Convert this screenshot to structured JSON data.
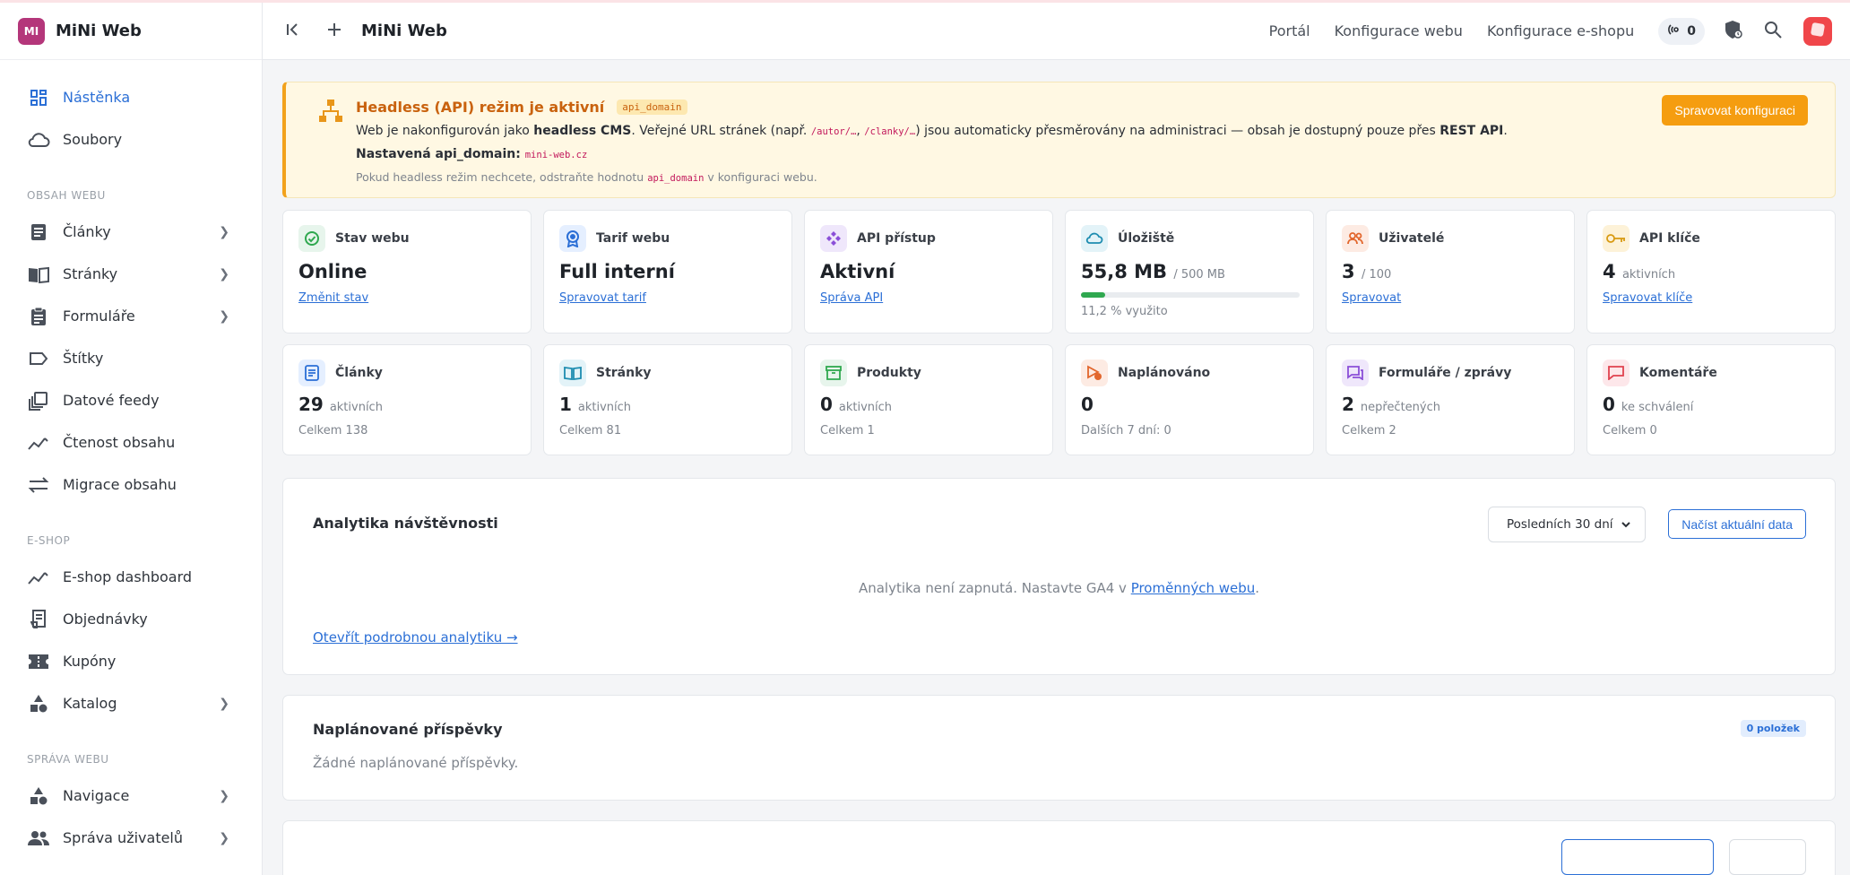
{
  "brand": {
    "logo_text": "MI",
    "name": "MiNi Web"
  },
  "sidebar": {
    "items_top": [
      {
        "label": "Nástěnka",
        "icon": "dashboard-icon",
        "active": true
      },
      {
        "label": "Soubory",
        "icon": "cloud-icon"
      }
    ],
    "section_content": "OBSAH WEBU",
    "items_content": [
      {
        "label": "Články",
        "icon": "article-icon",
        "chevron": true
      },
      {
        "label": "Stránky",
        "icon": "book-icon",
        "chevron": true
      },
      {
        "label": "Formuláře",
        "icon": "clipboard-icon",
        "chevron": true
      },
      {
        "label": "Štítky",
        "icon": "tag-icon"
      },
      {
        "label": "Datové feedy",
        "icon": "feed-icon"
      },
      {
        "label": "Čtenost obsahu",
        "icon": "trend-icon"
      },
      {
        "label": "Migrace obsahu",
        "icon": "swap-icon"
      }
    ],
    "section_eshop": "E-SHOP",
    "items_eshop": [
      {
        "label": "E-shop dashboard",
        "icon": "trend-icon"
      },
      {
        "label": "Objednávky",
        "icon": "receipt-icon"
      },
      {
        "label": "Kupóny",
        "icon": "ticket-icon"
      },
      {
        "label": "Katalog",
        "icon": "shapes-icon",
        "chevron": true
      }
    ],
    "section_manage": "SPRÁVA WEBU",
    "items_manage": [
      {
        "label": "Navigace",
        "icon": "shapes-icon",
        "chevron": true
      },
      {
        "label": "Správa uživatelů",
        "icon": "users-icon",
        "chevron": true
      }
    ]
  },
  "header": {
    "title": "MiNi Web",
    "links": [
      "Portál",
      "Konfigurace webu",
      "Konfigurace e-shopu"
    ],
    "counter": "0"
  },
  "alert": {
    "title": "Headless (API) režim je aktivní",
    "badge": "api_domain",
    "line1_a": "Web je nakonfigurován jako ",
    "line1_b": "headless CMS",
    "line1_c": ". Veřejné URL stránek (např. ",
    "line1_code1": "/autor/…",
    "line1_sep": ", ",
    "line1_code2": "/clanky/…",
    "line1_d": ") jsou automaticky přesměrovány na administraci — obsah je dostupný pouze přes ",
    "line1_e": "REST API",
    "line1_f": ".",
    "line2_label": "Nastavená api_domain: ",
    "line2_code": "mini-web.cz",
    "line3_a": "Pokud headless režim nechcete, odstraňte hodnotu ",
    "line3_code": "api_domain",
    "line3_b": " v konfiguraci webu.",
    "button": "Spravovat konfiguraci"
  },
  "cards_row1": [
    {
      "title": "Stav webu",
      "value": "Online",
      "link": "Změnit stav",
      "icon": "check-circle-icon",
      "tint": "#e7f5ec",
      "color": "#2fa84f"
    },
    {
      "title": "Tarif webu",
      "value": "Full interní",
      "link": "Spravovat tarif",
      "icon": "badge-icon",
      "tint": "#e5efff",
      "color": "#2b6fd6"
    },
    {
      "title": "API přístup",
      "value": "Aktivní",
      "link": "Správa API",
      "icon": "api-icon",
      "tint": "#efe7fb",
      "color": "#8b4fd8"
    },
    {
      "title": "Úložiště",
      "value": "55,8 MB",
      "suffix": "/ 500 MB",
      "note": "11,2 % využito",
      "progress": 0.112,
      "icon": "cloud-icon",
      "tint": "#e3f3f8",
      "color": "#1d8cb0"
    },
    {
      "title": "Uživatelé",
      "value": "3",
      "suffix": "/ 100",
      "link": "Spravovat",
      "icon": "users-icon",
      "tint": "#fdebe3",
      "color": "#e2662c"
    },
    {
      "title": "API klíče",
      "value": "4",
      "suffix": "aktivních",
      "link": "Spravovat klíče",
      "icon": "key-icon",
      "tint": "#fdf2d8",
      "color": "#d89a12"
    }
  ],
  "cards_row2": [
    {
      "title": "Články",
      "value": "29",
      "suffix": "aktivních",
      "note": "Celkem 138",
      "icon": "article-icon",
      "tint": "#e5efff",
      "color": "#2b6fd6"
    },
    {
      "title": "Stránky",
      "value": "1",
      "suffix": "aktivních",
      "note": "Celkem 81",
      "icon": "book-icon",
      "tint": "#e3f3f8",
      "color": "#1d8cb0"
    },
    {
      "title": "Produkty",
      "value": "0",
      "suffix": "aktivních",
      "note": "Celkem 1",
      "icon": "archive-icon",
      "tint": "#e7f5ec",
      "color": "#2fa84f"
    },
    {
      "title": "Naplánováno",
      "value": "0",
      "suffix": "",
      "note": "Dalších 7 dní: 0",
      "icon": "schedule-icon",
      "tint": "#fdebe3",
      "color": "#e2662c"
    },
    {
      "title": "Formuláře / zprávy",
      "value": "2",
      "suffix": "nepřečtených",
      "note": "Celkem 2",
      "icon": "chat-icon",
      "tint": "#efe7fb",
      "color": "#8b4fd8"
    },
    {
      "title": "Komentáře",
      "value": "0",
      "suffix": "ke schválení",
      "note": "Celkem 0",
      "icon": "comment-icon",
      "tint": "#fde7ea",
      "color": "#e0424f"
    }
  ],
  "analytics": {
    "title": "Analytika návštěvnosti",
    "select_value": "Posledních 30 dní",
    "button": "Načíst aktuální data",
    "info_a": "Analytika není zapnutá. Nastavte GA4 v ",
    "info_link": "Proměnných webu",
    "info_b": ".",
    "link": "Otevřít podrobnou analytiku →"
  },
  "scheduled": {
    "title": "Naplánované příspěvky",
    "badge": "0 položek",
    "empty": "Žádné naplánované příspěvky."
  }
}
